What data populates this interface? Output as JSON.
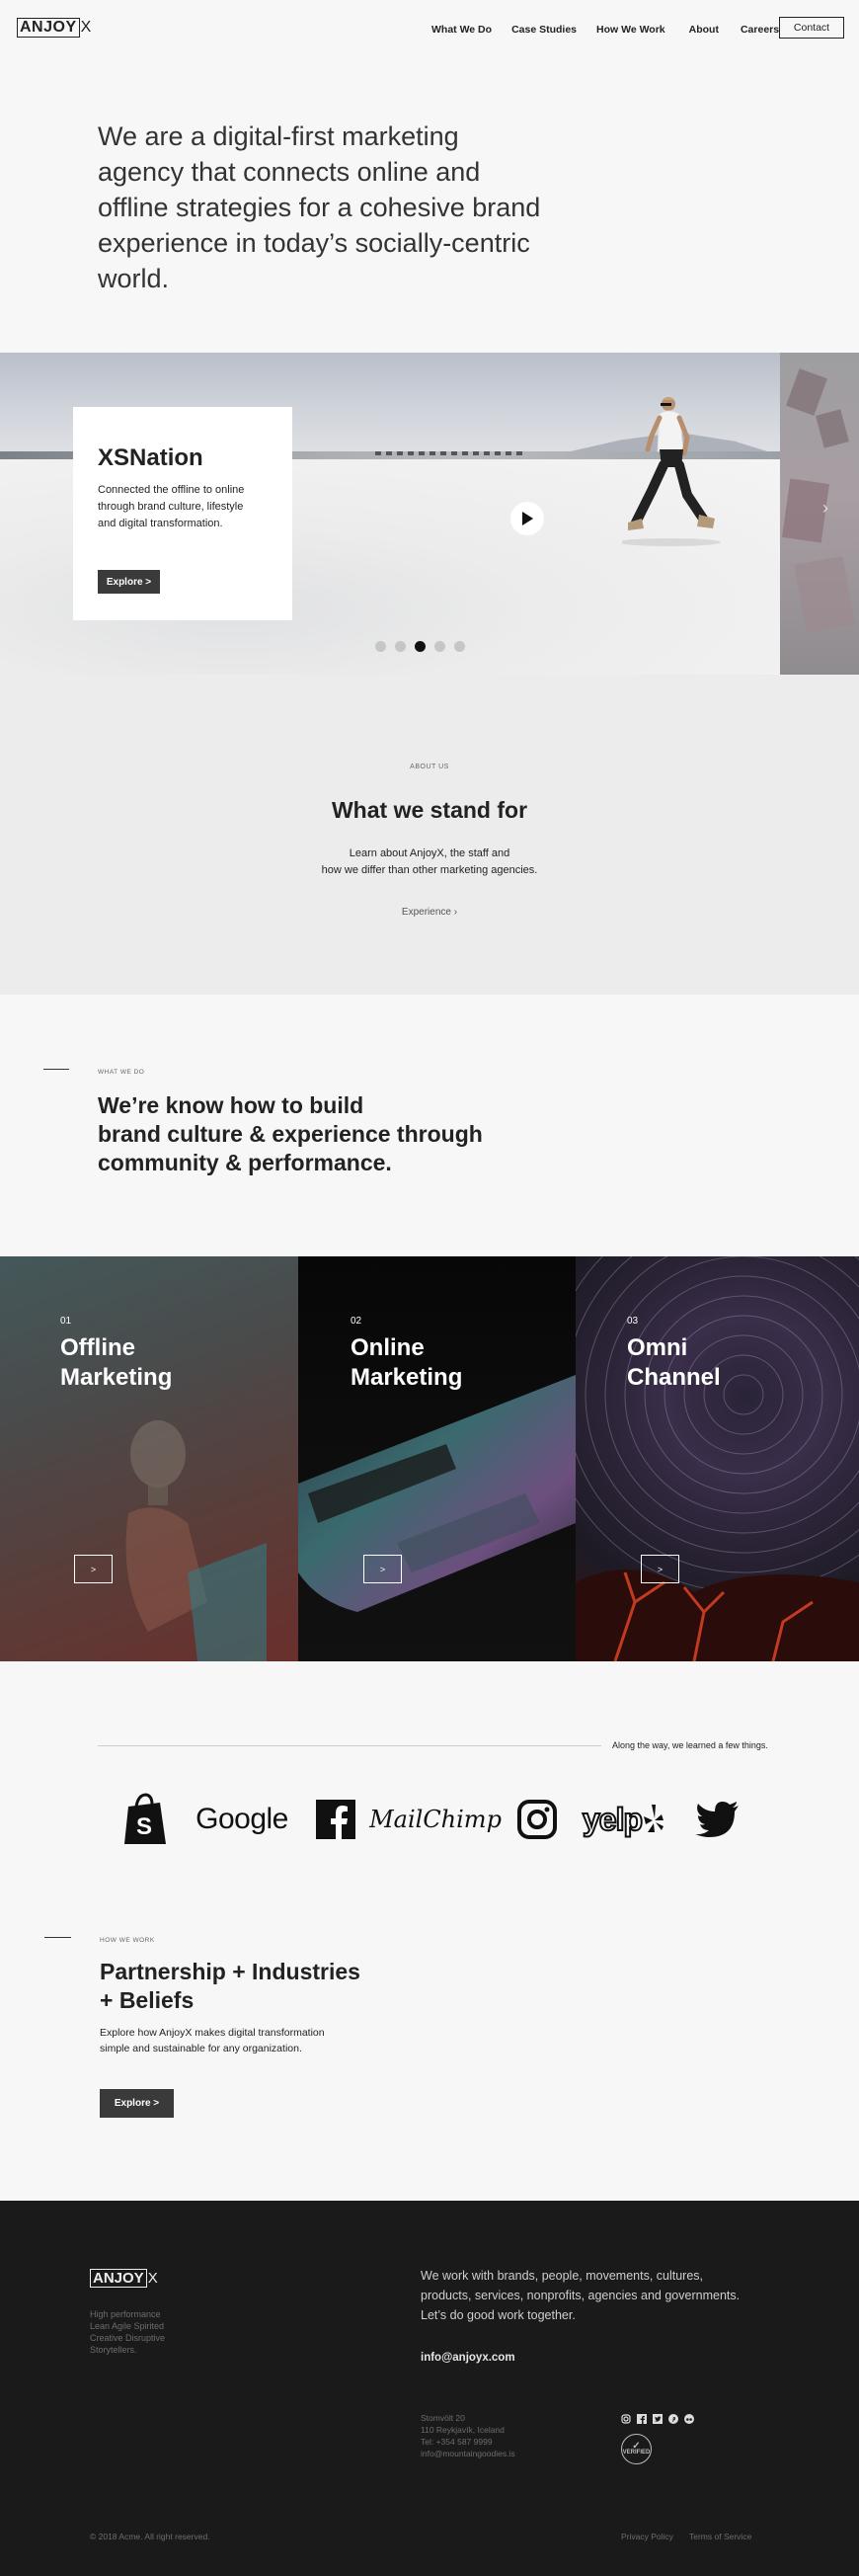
{
  "header": {
    "logo_main": "ANJOY",
    "logo_x": "X",
    "nav": [
      "What We Do",
      "Case Studies",
      "How We Work",
      "About",
      "Careers"
    ],
    "contact_label": "Contact"
  },
  "intro": {
    "text": "We are a digital-first marketing agency that connects online and offline strategies for a cohesive brand experience in today’s socially-centric world."
  },
  "hero": {
    "title": "XSNation",
    "description": "Connected the offline to online through brand culture, lifestyle and digital transformation.",
    "button_label": "Explore  >",
    "slides_count": 5,
    "active_slide_index": 2,
    "next_arrow": "›"
  },
  "about": {
    "eyebrow": "ABOUT US",
    "title": "What we stand for",
    "description_line1": "Learn about AnjoyX, the staff and",
    "description_line2": "how we differ than other marketing agencies.",
    "link_label": "Experience  ›"
  },
  "what_we_do": {
    "eyebrow": "WHAT WE DO",
    "title_line1": "We’re know how to build",
    "title_line2": "brand culture & experience through",
    "title_line3": "community & performance."
  },
  "services": [
    {
      "number": "01",
      "title_line1": "Offline",
      "title_line2": "Marketing",
      "button_label": ">"
    },
    {
      "number": "02",
      "title_line1": "Online",
      "title_line2": "Marketing",
      "button_label": ">"
    },
    {
      "number": "03",
      "title_line1": "Omni",
      "title_line2": "Channel",
      "button_label": ">"
    }
  ],
  "partners": {
    "caption": "Along the way, we learned a few things.",
    "brands": [
      "shopify-icon",
      "Google",
      "facebook-icon",
      "MailChimp",
      "instagram-icon",
      "yelp",
      "twitter-icon"
    ]
  },
  "how_we_work": {
    "eyebrow": "HOW WE WORK",
    "title_line1": "Partnership + Industries",
    "title_line2": "+ Beliefs",
    "description": "Explore how AnjoyX makes digital transformation simple and sustainable for any organization.",
    "button_label": "Explore  >"
  },
  "footer": {
    "logo_main": "ANJOY",
    "logo_x": "X",
    "tagline": [
      "High performance",
      "Lean Agile Spirited",
      "Creative Disruptive",
      "Storytellers."
    ],
    "pitch": "We work with brands, people, movements, cultures, products, services, nonprofits, agencies and governments. Let’s do good work together.",
    "email": "info@anjoyx.com",
    "address": [
      "Stomvölt 20",
      "110 Reykjavík, Iceland",
      "Tel: +354 587 9999",
      "info@mountaingoodies.is"
    ],
    "social_icons": [
      "instagram-icon",
      "facebook-icon",
      "twitter-icon",
      "pinterest-icon",
      "tripadvisor-icon"
    ],
    "badge_text": "VERIFIED",
    "copyright": "© 2018 Acme. All right reserved.",
    "privacy_label": "Privacy Policy",
    "terms_label": "Terms of Service"
  }
}
